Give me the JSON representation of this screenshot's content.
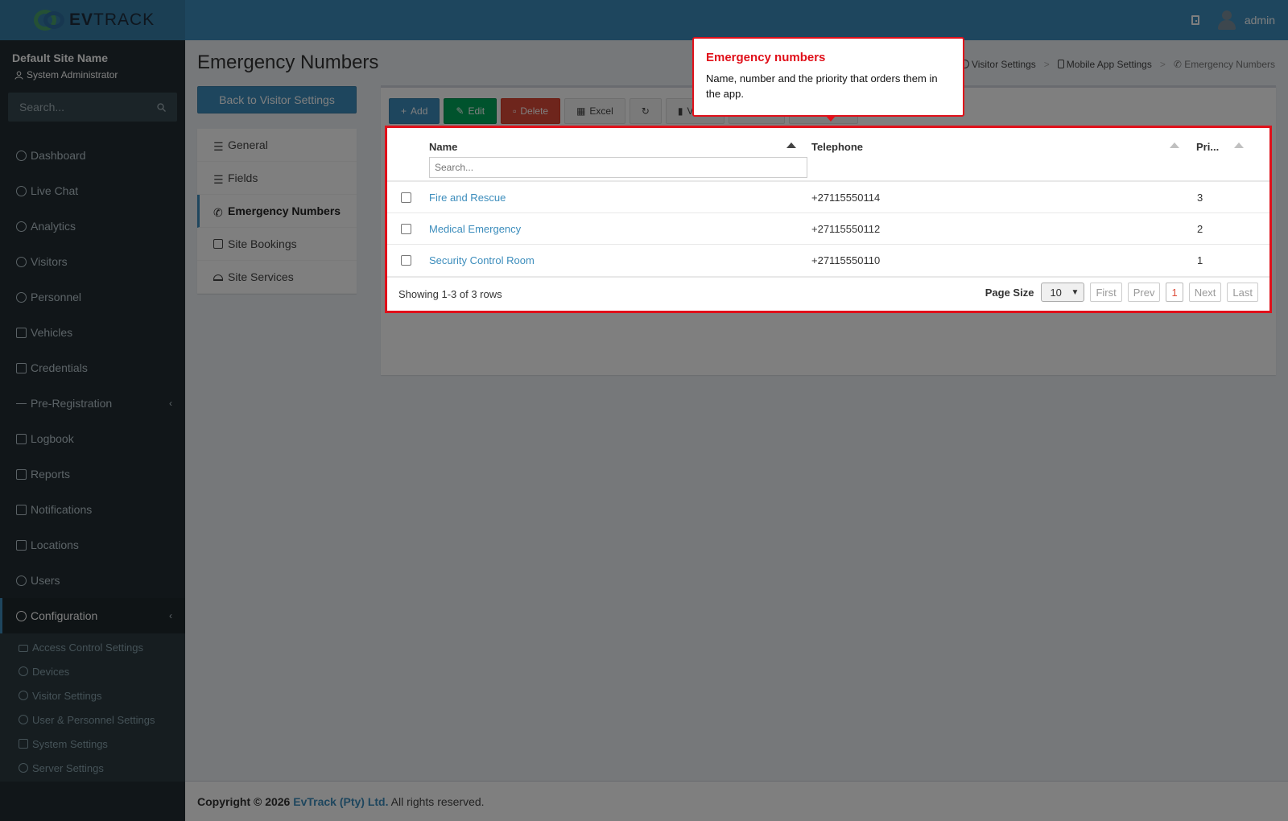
{
  "header": {
    "logo_text_bold": "EV",
    "logo_text_rest": "TRACK",
    "user_name": "admin",
    "colors": {
      "header": "#3c8dbc",
      "sidebar": "#222d32",
      "highlight": "#e0101a"
    }
  },
  "sidebar": {
    "site_name": "Default Site Name",
    "role": "System Administrator",
    "search_placeholder": "Search...",
    "items": [
      {
        "label": "Dashboard",
        "icon": "dashboard-icon"
      },
      {
        "label": "Live Chat",
        "icon": "headset-icon"
      },
      {
        "label": "Analytics",
        "icon": "analytics-icon"
      },
      {
        "label": "Visitors",
        "icon": "eye-icon"
      },
      {
        "label": "Personnel",
        "icon": "person-icon"
      },
      {
        "label": "Vehicles",
        "icon": "car-icon"
      },
      {
        "label": "Credentials",
        "icon": "id-card-icon"
      },
      {
        "label": "Pre-Registration",
        "icon": "arrows-icon"
      },
      {
        "label": "Logbook",
        "icon": "book-icon"
      },
      {
        "label": "Reports",
        "icon": "reports-icon"
      },
      {
        "label": "Notifications",
        "icon": "messages-icon"
      },
      {
        "label": "Locations",
        "icon": "map-icon"
      },
      {
        "label": "Users",
        "icon": "users-icon"
      },
      {
        "label": "Configuration",
        "icon": "gear-icon"
      }
    ],
    "submenu": [
      {
        "label": "Access Control Settings",
        "icon": "lock-icon"
      },
      {
        "label": "Devices",
        "icon": "device-icon"
      },
      {
        "label": "Visitor Settings",
        "icon": "eye-icon"
      },
      {
        "label": "User & Personnel Settings",
        "icon": "users-icon"
      },
      {
        "label": "System Settings",
        "icon": "sliders-icon"
      },
      {
        "label": "Server Settings",
        "icon": "server-icon"
      }
    ]
  },
  "page": {
    "title": "Emergency Numbers",
    "breadcrumb": [
      "Visitor Settings",
      "Mobile App Settings",
      "Emergency Numbers"
    ],
    "back_button": "Back to Visitor Settings",
    "left_nav": [
      "General",
      "Fields",
      "Emergency Numbers",
      "Site Bookings",
      "Site Services"
    ]
  },
  "toolbar": {
    "add": "Add",
    "edit": "Edit",
    "delete": "Delete",
    "excel": "Excel",
    "views": "Views"
  },
  "grid": {
    "columns": [
      "Name",
      "Telephone",
      "Pri..."
    ],
    "search_placeholder": "Search...",
    "rows": [
      {
        "name": "Fire and Rescue",
        "telephone": "+27115550114",
        "priority": "3"
      },
      {
        "name": "Medical Emergency",
        "telephone": "+27115550112",
        "priority": "2"
      },
      {
        "name": "Security Control Room",
        "telephone": "+27115550110",
        "priority": "1"
      }
    ],
    "showing": "Showing 1-3 of 3 rows",
    "page_size_label": "Page Size",
    "page_size": "10",
    "pager": {
      "first": "First",
      "prev": "Prev",
      "current": "1",
      "next": "Next",
      "last": "Last"
    }
  },
  "tooltip": {
    "title": "Emergency numbers",
    "body": "Name, number and the priority that orders them in the app."
  },
  "footer": {
    "prefix": "Copyright © 2026",
    "company": "EvTrack (Pty) Ltd.",
    "suffix": "All rights reserved."
  }
}
